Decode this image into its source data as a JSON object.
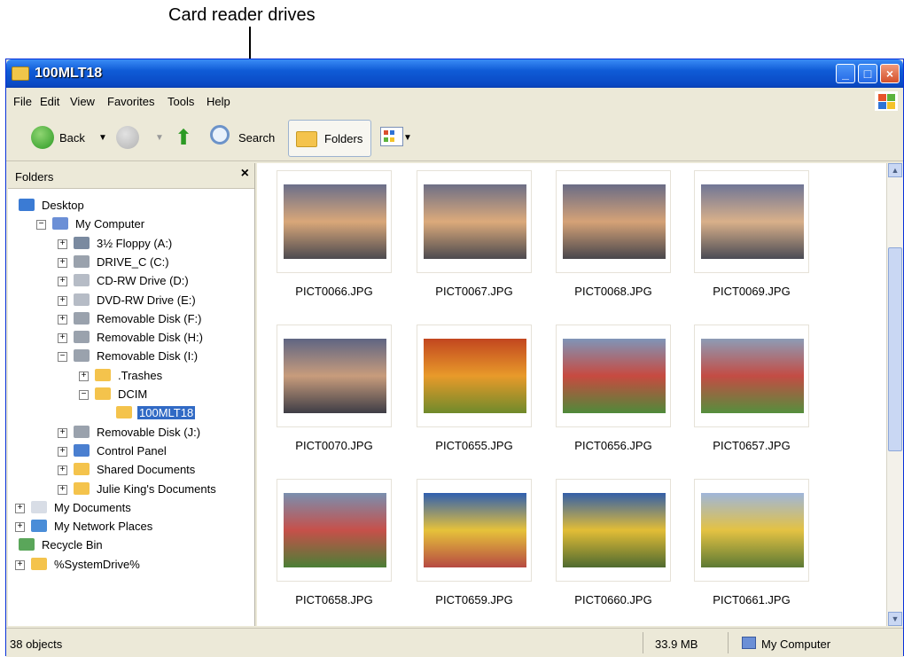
{
  "callout": "Card reader drives",
  "window": {
    "title": "100MLT18",
    "minimize": "_",
    "maximize": "□",
    "close": "×"
  },
  "menu": [
    "File",
    "Edit",
    "View",
    "Favorites",
    "Tools",
    "Help"
  ],
  "toolbar": {
    "back": "Back",
    "search": "Search",
    "folders": "Folders"
  },
  "folders_pane": {
    "title": "Folders",
    "close": "×",
    "tree": [
      {
        "label": "Desktop",
        "expander": "",
        "icon": "desktop-icon",
        "color": "#3b7bd4"
      },
      {
        "label": "My Computer",
        "expander": "−",
        "icon": "computer-icon",
        "color": "#6b8fd6"
      },
      {
        "label": "3½ Floppy (A:)",
        "expander": "+",
        "icon": "floppy-icon",
        "color": "#7a8aa0"
      },
      {
        "label": "DRIVE_C (C:)",
        "expander": "+",
        "icon": "hard-drive-icon",
        "color": "#9aa2ad"
      },
      {
        "label": "CD-RW Drive (D:)",
        "expander": "+",
        "icon": "cd-drive-icon",
        "color": "#b6bcc6"
      },
      {
        "label": "DVD-RW Drive (E:)",
        "expander": "+",
        "icon": "dvd-drive-icon",
        "color": "#b6bcc6"
      },
      {
        "label": "Removable Disk (F:)",
        "expander": "+",
        "icon": "removable-disk-icon",
        "color": "#9aa2ad"
      },
      {
        "label": "Removable Disk (H:)",
        "expander": "+",
        "icon": "removable-disk-icon",
        "color": "#9aa2ad"
      },
      {
        "label": "Removable Disk (I:)",
        "expander": "−",
        "icon": "removable-disk-icon",
        "color": "#9aa2ad"
      },
      {
        "label": ".Trashes",
        "expander": "+",
        "icon": "folder-icon",
        "color": "#f4c34c"
      },
      {
        "label": "DCIM",
        "expander": "−",
        "icon": "folder-icon",
        "color": "#f4c34c"
      },
      {
        "label": "100MLT18",
        "expander": "",
        "icon": "open-folder-icon",
        "color": "#f4c34c"
      },
      {
        "label": "Removable Disk (J:)",
        "expander": "+",
        "icon": "removable-disk-icon",
        "color": "#9aa2ad"
      },
      {
        "label": "Control Panel",
        "expander": "+",
        "icon": "control-panel-icon",
        "color": "#4a7fd0"
      },
      {
        "label": "Shared Documents",
        "expander": "+",
        "icon": "shared-folder-icon",
        "color": "#f4c34c"
      },
      {
        "label": "Julie King's Documents",
        "expander": "+",
        "icon": "folder-icon",
        "color": "#f4c34c"
      },
      {
        "label": "My Documents",
        "expander": "+",
        "icon": "documents-icon",
        "color": "#d8dde6"
      },
      {
        "label": "My Network Places",
        "expander": "+",
        "icon": "network-icon",
        "color": "#4a8dd8"
      },
      {
        "label": "Recycle Bin",
        "expander": "",
        "icon": "recycle-bin-icon",
        "color": "#5aa65a"
      },
      {
        "label": "%SystemDrive%",
        "expander": "+",
        "icon": "folder-icon",
        "color": "#f4c34c"
      }
    ]
  },
  "files": [
    {
      "name": "PICT0066.JPG",
      "colors": [
        "#6b6f8a",
        "#d9a779",
        "#4c4a50"
      ]
    },
    {
      "name": "PICT0067.JPG",
      "colors": [
        "#6e6f86",
        "#dcaa7b",
        "#4c4a4f"
      ]
    },
    {
      "name": "PICT0068.JPG",
      "colors": [
        "#6a6c86",
        "#d5a277",
        "#48464c"
      ]
    },
    {
      "name": "PICT0069.JPG",
      "colors": [
        "#707696",
        "#d9b08a",
        "#4a4b55"
      ]
    },
    {
      "name": "PICT0070.JPG",
      "colors": [
        "#5f6583",
        "#c89c7c",
        "#3e3d46"
      ]
    },
    {
      "name": "PICT0655.JPG",
      "colors": [
        "#c2461f",
        "#e89a2a",
        "#6f8a2b"
      ]
    },
    {
      "name": "PICT0656.JPG",
      "colors": [
        "#7f95b8",
        "#c74a40",
        "#4f8a3a"
      ]
    },
    {
      "name": "PICT0657.JPG",
      "colors": [
        "#8d9cb6",
        "#c34c44",
        "#558f3d"
      ]
    },
    {
      "name": "PICT0658.JPG",
      "colors": [
        "#7a8faf",
        "#c6504a",
        "#4b7f36"
      ]
    },
    {
      "name": "PICT0659.JPG",
      "colors": [
        "#2f5fb0",
        "#e6c23a",
        "#b64a42"
      ]
    },
    {
      "name": "PICT0660.JPG",
      "colors": [
        "#335fa8",
        "#e2bd36",
        "#4f6a30"
      ]
    },
    {
      "name": "PICT0661.JPG",
      "colors": [
        "#9fb6da",
        "#e4c243",
        "#5d7a34"
      ]
    }
  ],
  "status": {
    "objects": "38 objects",
    "size": "33.9 MB",
    "location": "My Computer"
  }
}
